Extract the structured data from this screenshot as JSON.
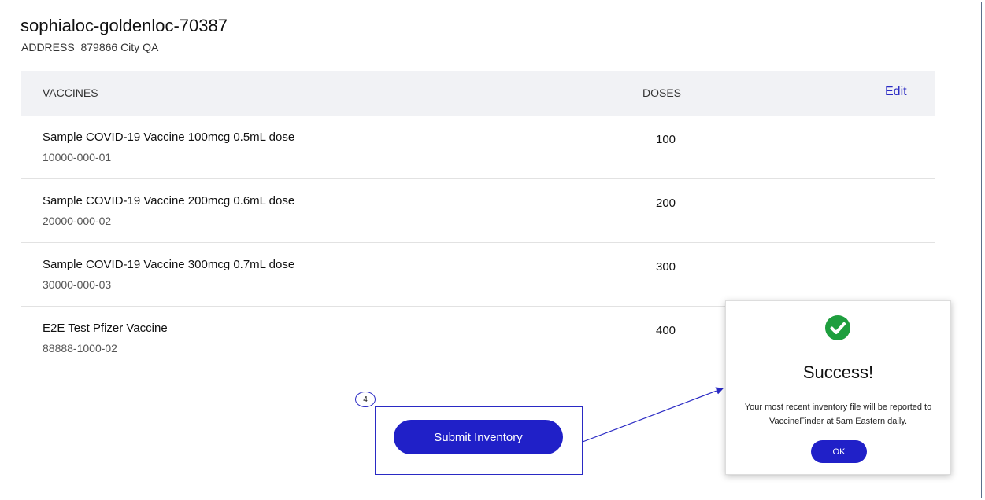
{
  "location": {
    "title": "sophialoc-goldenloc-70387",
    "address": "ADDRESS_879866 City QA"
  },
  "table": {
    "col_vaccines": "VACCINES",
    "col_doses": "DOSES",
    "edit_label": "Edit",
    "rows": [
      {
        "name": "Sample COVID-19 Vaccine 100mcg 0.5mL dose",
        "code": "10000-000-01",
        "doses": "100"
      },
      {
        "name": "Sample COVID-19 Vaccine 200mcg 0.6mL dose",
        "code": "20000-000-02",
        "doses": "200"
      },
      {
        "name": "Sample COVID-19 Vaccine 300mcg 0.7mL dose",
        "code": "30000-000-03",
        "doses": "300"
      },
      {
        "name": "E2E Test Pfizer Vaccine",
        "code": "88888-1000-02",
        "doses": "400"
      }
    ]
  },
  "annotation": {
    "step_number": "4",
    "color": "#2a2ac4"
  },
  "actions": {
    "submit_label": "Submit Inventory"
  },
  "modal": {
    "icon": "check-circle-icon",
    "icon_color": "#1e9e3e",
    "title": "Success!",
    "message": "Your most recent inventory file will be reported to VaccineFinder at 5am Eastern daily.",
    "ok_label": "OK"
  }
}
